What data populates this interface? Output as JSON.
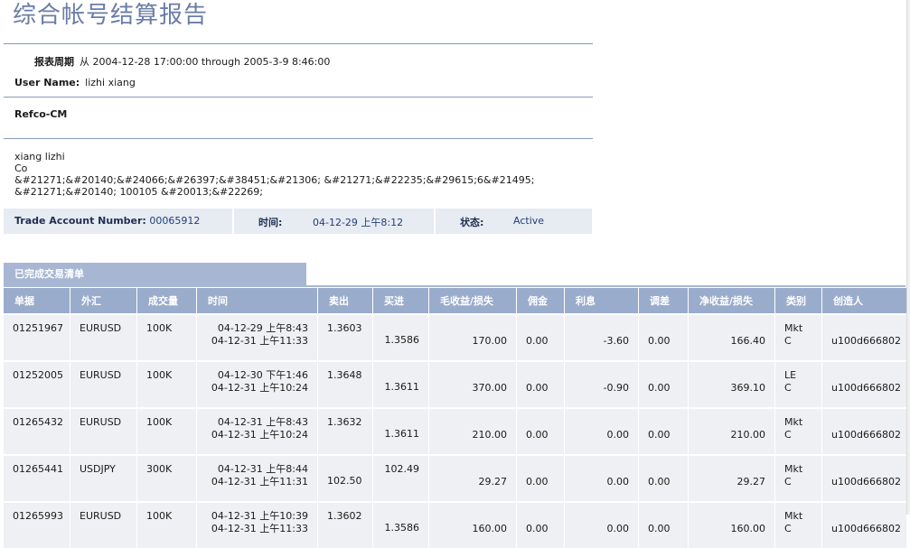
{
  "report": {
    "title": "综合帐号结算报告",
    "period_label": "报表周期",
    "period_value": "从 2004-12-28 17:00:00 through 2005-3-9 8:46:00",
    "user_label": "User Name:",
    "user_value": "lizhi xiang",
    "company": "Refco-CM",
    "address": "xiang lizhi\nCo\n&#21271;&#20140;&#24066;&#26397;&#38451;&#21306; &#21271;&#22235;&#29615;6&#21495;\n&#21271;&#20140; 100105 &#20013;&#22269;"
  },
  "account": {
    "number_label": "Trade Account Number:",
    "number_value": "00065912",
    "time_label": "时间:",
    "time_value": "04-12-29 上午8:12",
    "status_label": "状态:",
    "status_value": "Active"
  },
  "section": {
    "title": "已完成交易清单"
  },
  "columns": [
    "单据",
    "外汇",
    "成交量",
    "时间",
    "卖出",
    "买进",
    "毛收益/损失",
    "佣金",
    "利息",
    "调差",
    "净收益/损失",
    "类别",
    "创造人"
  ],
  "rows": [
    {
      "id": "01251967",
      "pair": "EURUSD",
      "volume": "100K",
      "time1": "04-12-29 上午8:43",
      "time2": "04-12-31 上午11:33",
      "sell": "1.3603",
      "sell_low": "",
      "buy": "",
      "buy_low": "1.3586",
      "gross": "170.00",
      "commission": "0.00",
      "interest": "-3.60",
      "adjust": "0.00",
      "net": "166.40",
      "type1": "Mkt",
      "type2": "C",
      "creator": "u100d666802"
    },
    {
      "id": "01252005",
      "pair": "EURUSD",
      "volume": "100K",
      "time1": "04-12-30 下午1:46",
      "time2": "04-12-31 上午10:24",
      "sell": "1.3648",
      "sell_low": "",
      "buy": "",
      "buy_low": "1.3611",
      "gross": "370.00",
      "commission": "0.00",
      "interest": "-0.90",
      "adjust": "0.00",
      "net": "369.10",
      "type1": "LE",
      "type2": "C",
      "creator": "u100d666802"
    },
    {
      "id": "01265432",
      "pair": "EURUSD",
      "volume": "100K",
      "time1": "04-12-31 上午8:43",
      "time2": "04-12-31 上午10:24",
      "sell": "1.3632",
      "sell_low": "",
      "buy": "",
      "buy_low": "1.3611",
      "gross": "210.00",
      "commission": "0.00",
      "interest": "0.00",
      "adjust": "0.00",
      "net": "210.00",
      "type1": "Mkt",
      "type2": "C",
      "creator": "u100d666802"
    },
    {
      "id": "01265441",
      "pair": "USDJPY",
      "volume": "300K",
      "time1": "04-12-31 上午8:44",
      "time2": "04-12-31 上午11:31",
      "sell": "",
      "sell_low": "102.50",
      "buy": "102.49",
      "buy_low": "",
      "gross": "29.27",
      "commission": "0.00",
      "interest": "0.00",
      "adjust": "0.00",
      "net": "29.27",
      "type1": "Mkt",
      "type2": "C",
      "creator": "u100d666802"
    },
    {
      "id": "01265993",
      "pair": "EURUSD",
      "volume": "100K",
      "time1": "04-12-31 上午10:39",
      "time2": "04-12-31 上午11:33",
      "sell": "1.3602",
      "sell_low": "",
      "buy": "",
      "buy_low": "1.3586",
      "gross": "160.00",
      "commission": "0.00",
      "interest": "0.00",
      "adjust": "0.00",
      "net": "160.00",
      "type1": "Mkt",
      "type2": "C",
      "creator": "u100d666802"
    }
  ],
  "colors": {
    "title": "#6a7da6",
    "header": "#9aaccb",
    "tab": "#a7b7d3",
    "row": "#eff0f3",
    "account_bar": "#e7ebf2"
  }
}
